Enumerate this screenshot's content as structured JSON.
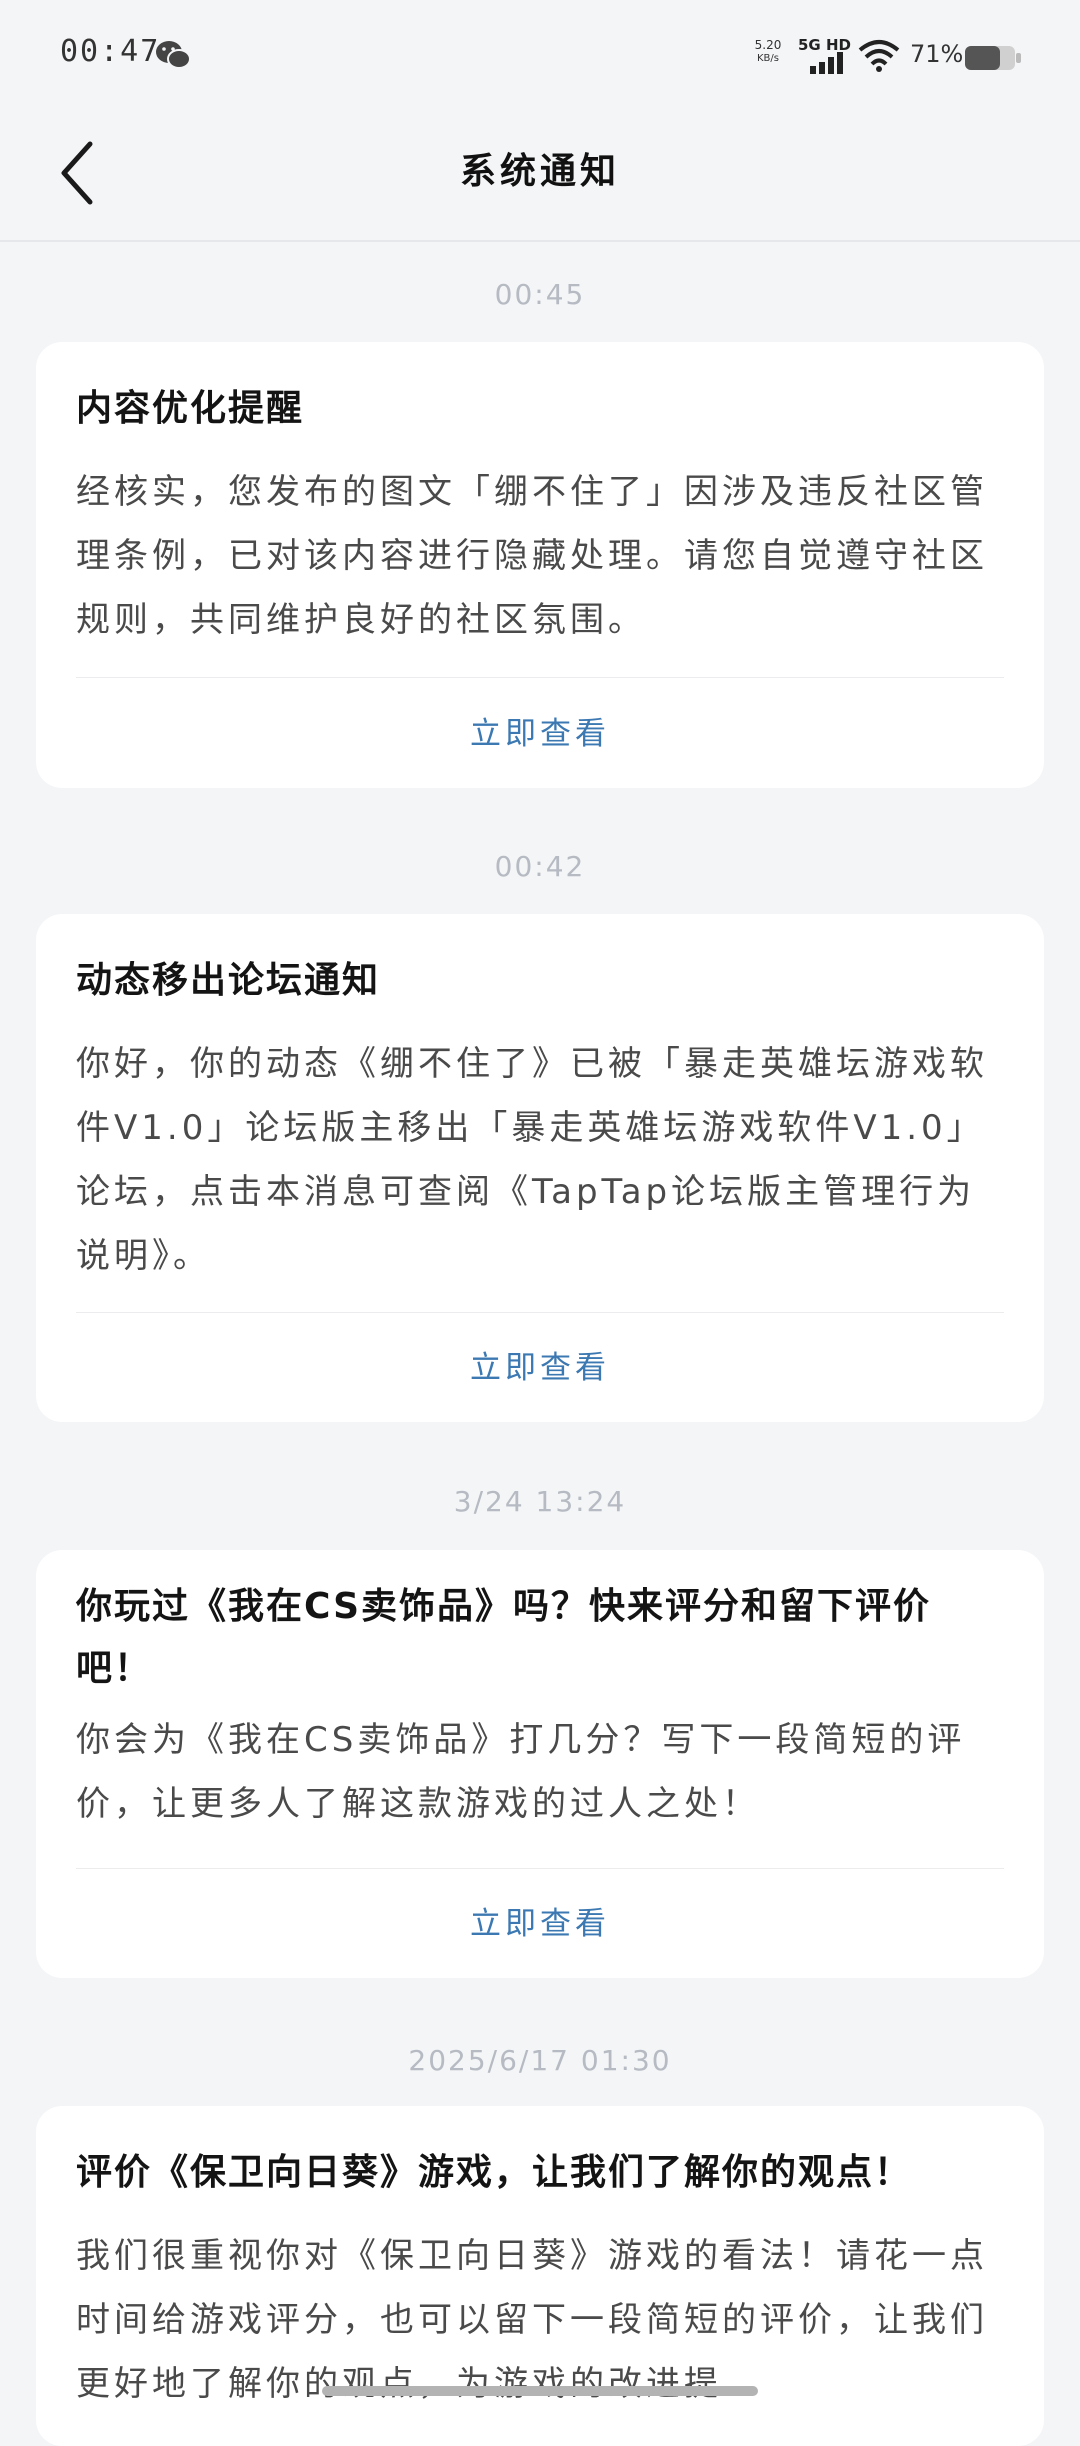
{
  "status_bar": {
    "time": "00:47",
    "net_speed_value": "5.20",
    "net_speed_unit": "KB/s",
    "network": "5G HD",
    "battery": "71%"
  },
  "nav": {
    "title": "系统通知"
  },
  "notifications": [
    {
      "time": "00:45",
      "title": "内容优化提醒",
      "body": "经核实，您发布的图文「绷不住了」因涉及违反社区管理条例，已对该内容进行隐藏处理。请您自觉遵守社区规则，共同维护良好的社区氛围。",
      "action": "立即查看"
    },
    {
      "time": "00:42",
      "title": "动态移出论坛通知",
      "body": "你好，你的动态《绷不住了》已被「暴走英雄坛游戏软件V1.0」论坛版主移出「暴走英雄坛游戏软件V1.0」论坛，点击本消息可查阅《TapTap论坛版主管理行为说明》。",
      "action": "立即查看"
    },
    {
      "time": "3/24  13:24",
      "title": "你玩过《我在CS卖饰品》吗？快来评分和留下评价吧！",
      "body": "你会为《我在CS卖饰品》打几分？写下一段简短的评价，让更多人了解这款游戏的过人之处！",
      "action": "立即查看"
    },
    {
      "time": "2025/6/17  01:30",
      "title": "评价《保卫向日葵》游戏，让我们了解你的观点！",
      "body": "我们很重视你对《保卫向日葵》游戏的看法！请花一点时间给游戏评分，也可以留下一段简短的评价，让我们更好地了解你的观点，为游戏的改进提",
      "action": ""
    }
  ],
  "colors": {
    "background": "#f4f5f7",
    "card": "#ffffff",
    "action": "#3c78b2",
    "timestamp": "#b6bac2"
  }
}
